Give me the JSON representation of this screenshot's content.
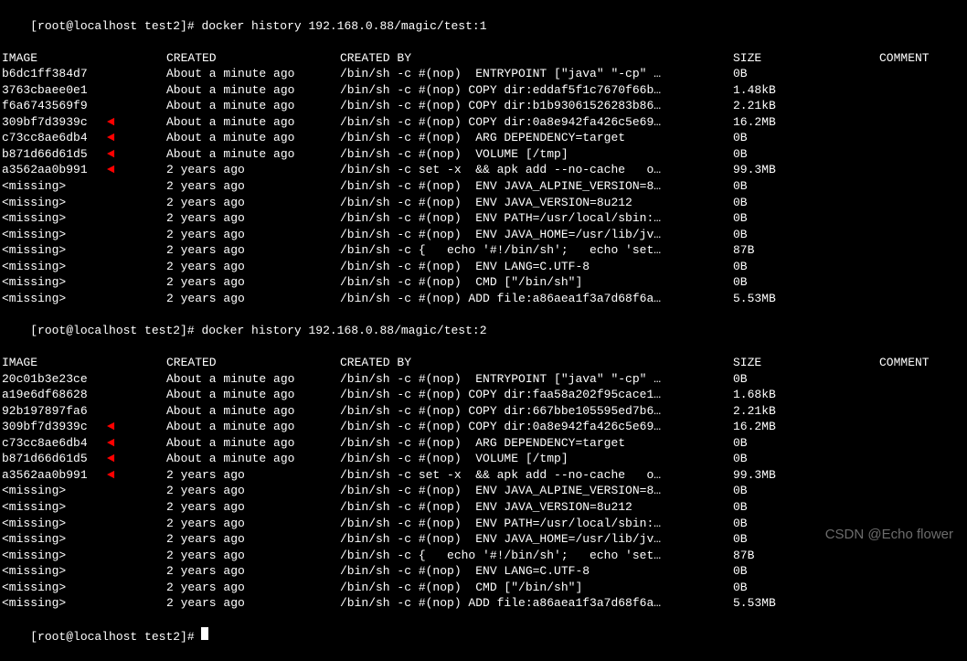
{
  "watermark": "CSDN @Echo flower",
  "headers": {
    "image": "IMAGE",
    "created": "CREATED",
    "createdby": "CREATED BY",
    "size": "SIZE",
    "comment": "COMMENT"
  },
  "block1": {
    "prompt": "[root@localhost test2]# docker history 192.168.0.88/magic/test:1",
    "rows": [
      {
        "image": "b6dc1ff384d7",
        "created": "About a minute ago",
        "createdby": "/bin/sh -c #(nop)  ENTRYPOINT [\"java\" \"-cp\" …",
        "size": "0B",
        "arrow": false
      },
      {
        "image": "3763cbaee0e1",
        "created": "About a minute ago",
        "createdby": "/bin/sh -c #(nop) COPY dir:eddaf5f1c7670f66b…",
        "size": "1.48kB",
        "arrow": false
      },
      {
        "image": "f6a6743569f9",
        "created": "About a minute ago",
        "createdby": "/bin/sh -c #(nop) COPY dir:b1b93061526283b86…",
        "size": "2.21kB",
        "arrow": false
      },
      {
        "image": "309bf7d3939c",
        "created": "About a minute ago",
        "createdby": "/bin/sh -c #(nop) COPY dir:0a8e942fa426c5e69…",
        "size": "16.2MB",
        "arrow": true
      },
      {
        "image": "c73cc8ae6db4",
        "created": "About a minute ago",
        "createdby": "/bin/sh -c #(nop)  ARG DEPENDENCY=target",
        "size": "0B",
        "arrow": true
      },
      {
        "image": "b871d66d61d5",
        "created": "About a minute ago",
        "createdby": "/bin/sh -c #(nop)  VOLUME [/tmp]",
        "size": "0B",
        "arrow": true
      },
      {
        "image": "a3562aa0b991",
        "created": "2 years ago",
        "createdby": "/bin/sh -c set -x  && apk add --no-cache   o…",
        "size": "99.3MB",
        "arrow": true
      },
      {
        "image": "<missing>",
        "created": "2 years ago",
        "createdby": "/bin/sh -c #(nop)  ENV JAVA_ALPINE_VERSION=8…",
        "size": "0B",
        "arrow": false
      },
      {
        "image": "<missing>",
        "created": "2 years ago",
        "createdby": "/bin/sh -c #(nop)  ENV JAVA_VERSION=8u212",
        "size": "0B",
        "arrow": false
      },
      {
        "image": "<missing>",
        "created": "2 years ago",
        "createdby": "/bin/sh -c #(nop)  ENV PATH=/usr/local/sbin:…",
        "size": "0B",
        "arrow": false
      },
      {
        "image": "<missing>",
        "created": "2 years ago",
        "createdby": "/bin/sh -c #(nop)  ENV JAVA_HOME=/usr/lib/jv…",
        "size": "0B",
        "arrow": false
      },
      {
        "image": "<missing>",
        "created": "2 years ago",
        "createdby": "/bin/sh -c {   echo '#!/bin/sh';   echo 'set…",
        "size": "87B",
        "arrow": false
      },
      {
        "image": "<missing>",
        "created": "2 years ago",
        "createdby": "/bin/sh -c #(nop)  ENV LANG=C.UTF-8",
        "size": "0B",
        "arrow": false
      },
      {
        "image": "<missing>",
        "created": "2 years ago",
        "createdby": "/bin/sh -c #(nop)  CMD [\"/bin/sh\"]",
        "size": "0B",
        "arrow": false
      },
      {
        "image": "<missing>",
        "created": "2 years ago",
        "createdby": "/bin/sh -c #(nop) ADD file:a86aea1f3a7d68f6a…",
        "size": "5.53MB",
        "arrow": false
      }
    ]
  },
  "block2": {
    "prompt": "[root@localhost test2]# docker history 192.168.0.88/magic/test:2",
    "rows": [
      {
        "image": "20c01b3e23ce",
        "created": "About a minute ago",
        "createdby": "/bin/sh -c #(nop)  ENTRYPOINT [\"java\" \"-cp\" …",
        "size": "0B",
        "arrow": false
      },
      {
        "image": "a19e6df68628",
        "created": "About a minute ago",
        "createdby": "/bin/sh -c #(nop) COPY dir:faa58a202f95cace1…",
        "size": "1.68kB",
        "arrow": false
      },
      {
        "image": "92b197897fa6",
        "created": "About a minute ago",
        "createdby": "/bin/sh -c #(nop) COPY dir:667bbe105595ed7b6…",
        "size": "2.21kB",
        "arrow": false
      },
      {
        "image": "309bf7d3939c",
        "created": "About a minute ago",
        "createdby": "/bin/sh -c #(nop) COPY dir:0a8e942fa426c5e69…",
        "size": "16.2MB",
        "arrow": true
      },
      {
        "image": "c73cc8ae6db4",
        "created": "About a minute ago",
        "createdby": "/bin/sh -c #(nop)  ARG DEPENDENCY=target",
        "size": "0B",
        "arrow": true
      },
      {
        "image": "b871d66d61d5",
        "created": "About a minute ago",
        "createdby": "/bin/sh -c #(nop)  VOLUME [/tmp]",
        "size": "0B",
        "arrow": true
      },
      {
        "image": "a3562aa0b991",
        "created": "2 years ago",
        "createdby": "/bin/sh -c set -x  && apk add --no-cache   o…",
        "size": "99.3MB",
        "arrow": true
      },
      {
        "image": "<missing>",
        "created": "2 years ago",
        "createdby": "/bin/sh -c #(nop)  ENV JAVA_ALPINE_VERSION=8…",
        "size": "0B",
        "arrow": false
      },
      {
        "image": "<missing>",
        "created": "2 years ago",
        "createdby": "/bin/sh -c #(nop)  ENV JAVA_VERSION=8u212",
        "size": "0B",
        "arrow": false
      },
      {
        "image": "<missing>",
        "created": "2 years ago",
        "createdby": "/bin/sh -c #(nop)  ENV PATH=/usr/local/sbin:…",
        "size": "0B",
        "arrow": false
      },
      {
        "image": "<missing>",
        "created": "2 years ago",
        "createdby": "/bin/sh -c #(nop)  ENV JAVA_HOME=/usr/lib/jv…",
        "size": "0B",
        "arrow": false
      },
      {
        "image": "<missing>",
        "created": "2 years ago",
        "createdby": "/bin/sh -c {   echo '#!/bin/sh';   echo 'set…",
        "size": "87B",
        "arrow": false
      },
      {
        "image": "<missing>",
        "created": "2 years ago",
        "createdby": "/bin/sh -c #(nop)  ENV LANG=C.UTF-8",
        "size": "0B",
        "arrow": false
      },
      {
        "image": "<missing>",
        "created": "2 years ago",
        "createdby": "/bin/sh -c #(nop)  CMD [\"/bin/sh\"]",
        "size": "0B",
        "arrow": false
      },
      {
        "image": "<missing>",
        "created": "2 years ago",
        "createdby": "/bin/sh -c #(nop) ADD file:a86aea1f3a7d68f6a…",
        "size": "5.53MB",
        "arrow": false
      }
    ]
  },
  "final_prompt": "[root@localhost test2]# "
}
